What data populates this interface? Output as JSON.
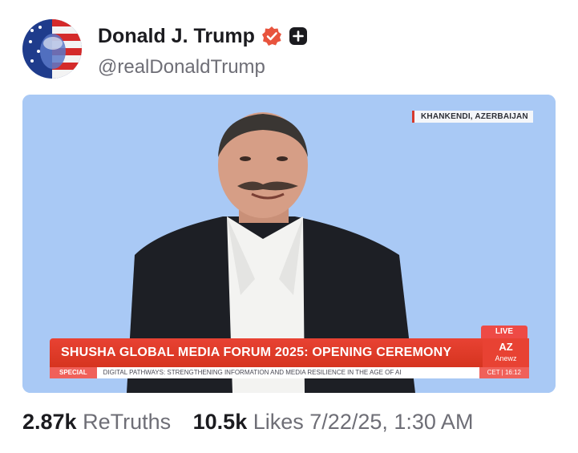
{
  "post": {
    "display_name": "Donald J. Trump",
    "handle": "@realDonaldTrump",
    "badge_icon": "verified-badge-icon",
    "badge_color": "#e8543e",
    "plus_icon": "plus-square-icon"
  },
  "media": {
    "location": "KHANKENDI, AZERBAIJAN",
    "live_label": "LIVE",
    "headline": "SHUSHA GLOBAL MEDIA FORUM 2025: OPENING CEREMONY",
    "ticker_label": "SPECIAL",
    "ticker_text": "DIGITAL PATHWAYS: STRENGTHENING INFORMATION AND MEDIA RESILIENCE IN THE AGE OF AI",
    "ticker_time": "CET | 16:12",
    "logo_mark": "AZ",
    "logo_text": "Anewz",
    "background_color": "#a8c8f4",
    "accent_color": "#e84233"
  },
  "stats": {
    "retruths_count": "2.87k",
    "retruths_label": "ReTruths",
    "likes_count": "10.5k",
    "likes_label": "Likes",
    "timestamp": "7/22/25, 1:30 AM"
  }
}
